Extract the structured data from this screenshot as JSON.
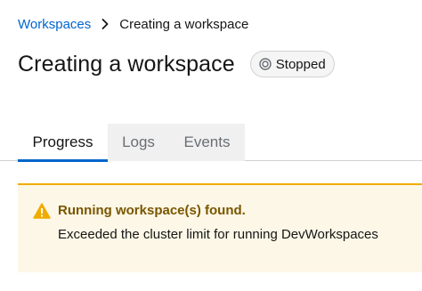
{
  "breadcrumb": {
    "parent": "Workspaces",
    "separator_icon": "chevron-right-icon",
    "current": "Creating a workspace"
  },
  "header": {
    "title": "Creating a workspace",
    "status": {
      "label": "Stopped",
      "icon": "stopped-circle-icon"
    }
  },
  "tabs": [
    {
      "label": "Progress",
      "active": true
    },
    {
      "label": "Logs",
      "active": false
    },
    {
      "label": "Events",
      "active": false
    }
  ],
  "alert": {
    "variant": "warning",
    "icon": "warning-triangle-icon",
    "title": "Running workspace(s) found.",
    "description": "Exceeded the cluster limit for running DevWorkspaces"
  },
  "colors": {
    "link": "#0066cc",
    "active_tab_underline": "#0066cc",
    "warning_border": "#f0ab00",
    "warning_bg": "#fdf7e7",
    "warning_title": "#795600"
  }
}
